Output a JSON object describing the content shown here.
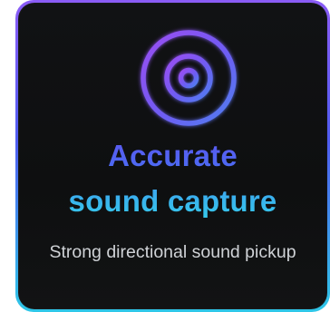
{
  "card": {
    "icon_name": "target-sound-capture-icon",
    "title_line_1": "Accurate",
    "title_line_2": "sound capture",
    "description": "Strong directional sound pickup"
  },
  "colors": {
    "border_gradient_top": "#8b5cf6",
    "border_gradient_mid": "#4f5cf0",
    "border_gradient_bottom": "#2ec7e8",
    "card_background": "#111214",
    "title_line_1": "#5163f1",
    "title_line_2": "#3ab6ed",
    "description": "#cfd2d6"
  }
}
